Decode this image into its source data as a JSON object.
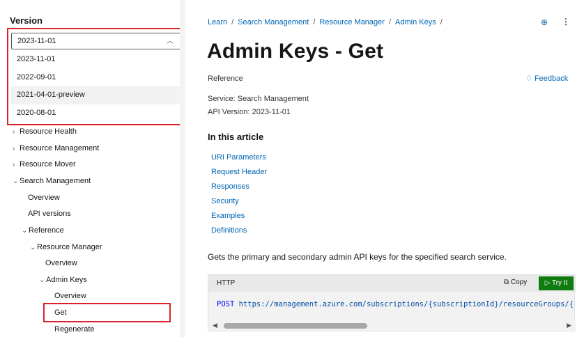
{
  "sidebar": {
    "version_label": "Version",
    "version_selected": "2023-11-01",
    "version_options": [
      "2023-11-01",
      "2022-09-01",
      "2021-04-01-preview",
      "2020-08-01"
    ],
    "nav": [
      {
        "label": "Resource Health",
        "chevron": "›"
      },
      {
        "label": "Resource Management",
        "chevron": "›"
      },
      {
        "label": "Resource Mover",
        "chevron": "›"
      },
      {
        "label": "Search Management",
        "chevron": "⌄"
      },
      {
        "label": "Overview",
        "chevron": ""
      },
      {
        "label": "API versions",
        "chevron": ""
      },
      {
        "label": "Reference",
        "chevron": "⌄"
      },
      {
        "label": "Resource Manager",
        "chevron": "⌄"
      },
      {
        "label": "Overview",
        "chevron": ""
      },
      {
        "label": "Admin Keys",
        "chevron": "⌄"
      },
      {
        "label": "Overview",
        "chevron": ""
      },
      {
        "label": "Get",
        "chevron": ""
      },
      {
        "label": "Regenerate",
        "chevron": ""
      }
    ]
  },
  "breadcrumb": [
    "Learn",
    "Search Management",
    "Resource Manager",
    "Admin Keys"
  ],
  "page": {
    "title": "Admin Keys - Get",
    "reference_label": "Reference",
    "feedback_label": "Feedback",
    "service_line": "Service:  Search Management",
    "api_version_line": "API Version:  2023-11-01",
    "in_this_article": "In this article",
    "toc": [
      "URI Parameters",
      "Request Header",
      "Responses",
      "Security",
      "Examples",
      "Definitions"
    ],
    "description": "Gets the primary and secondary admin API keys for the specified search service."
  },
  "code": {
    "language": "HTTP",
    "copy_label": "Copy",
    "try_label": "Try It",
    "method": "POST",
    "url": "https://management.azure.com/subscriptions/{subscriptionId}/resourceGroups/{resourceGroupName}"
  },
  "colors": {
    "link": "#0065b3",
    "highlight_border": "#d9242b",
    "try_button": "#107c10"
  }
}
